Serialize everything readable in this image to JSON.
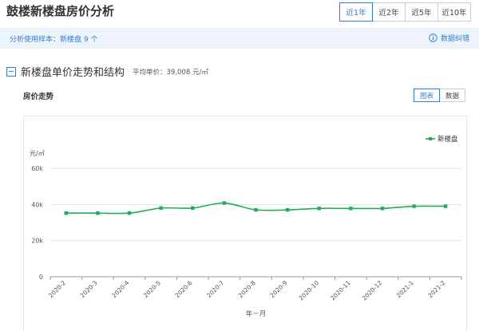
{
  "page": {
    "title": "鼓楼新楼盘房价分析",
    "range_tabs": [
      {
        "label": "近1年",
        "active": true
      },
      {
        "label": "近2年",
        "active": false
      },
      {
        "label": "近5年",
        "active": false
      },
      {
        "label": "近10年",
        "active": false
      }
    ]
  },
  "sample": {
    "text": "分析使用样本：新楼盘 9 个",
    "feedback_label": "数据纠错"
  },
  "section": {
    "title": "新楼盘单价走势和结构",
    "avg_price": "平均单价：39,008 元/㎡"
  },
  "trend": {
    "title": "房价走势",
    "view_tabs": [
      {
        "label": "图表",
        "active": true
      },
      {
        "label": "数据",
        "active": false
      }
    ]
  },
  "colors": {
    "accent": "#2f7de1",
    "series": "#1fae55",
    "sample_bg": "#eef4fc"
  },
  "chart_data": {
    "type": "line",
    "x": [
      "2020-2",
      "2020-3",
      "2020-4",
      "2020-5",
      "2020-6",
      "2020-7",
      "2020-8",
      "2020-9",
      "2020-10",
      "2020-11",
      "2020-12",
      "2021-1",
      "2021-2"
    ],
    "series": [
      {
        "name": "新楼盘",
        "values": [
          35200,
          35200,
          35200,
          38000,
          38000,
          40800,
          37000,
          37000,
          37800,
          37800,
          37800,
          39000,
          39000
        ]
      }
    ],
    "ylabel": "元/㎡",
    "xlabel": "年－月",
    "ylim": [
      0,
      60000
    ],
    "yticks": [
      0,
      20000,
      40000,
      60000
    ],
    "ytick_labels": [
      "0",
      "20k",
      "40k",
      "60k"
    ],
    "legend": "top-right",
    "grid": true,
    "smooth": true
  }
}
